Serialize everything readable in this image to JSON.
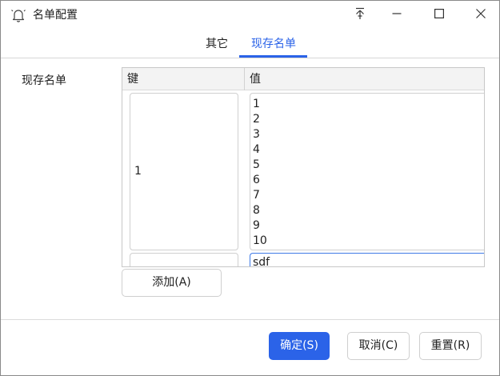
{
  "window": {
    "title": "名单配置",
    "icons": {
      "app": "bell-icon",
      "pin": "pin-icon",
      "minimize": "minimize-icon",
      "maximize": "maximize-icon",
      "close": "close-icon"
    }
  },
  "tabs": [
    {
      "label": "其它",
      "active": false
    },
    {
      "label": "现存名单",
      "active": true
    }
  ],
  "form": {
    "field_label": "现存名单",
    "table": {
      "columns": [
        "键",
        "值"
      ],
      "rows": [
        {
          "key": "1",
          "value": [
            "1",
            "2",
            "3",
            "4",
            "5",
            "6",
            "7",
            "8",
            "9",
            "10"
          ]
        },
        {
          "key": "",
          "value": [
            "sdf"
          ]
        }
      ]
    },
    "add_button": "添加(A)"
  },
  "footer": {
    "ok": "确定(S)",
    "cancel": "取消(C)",
    "reset": "重置(R)"
  },
  "colors": {
    "accent": "#2b63e8"
  }
}
